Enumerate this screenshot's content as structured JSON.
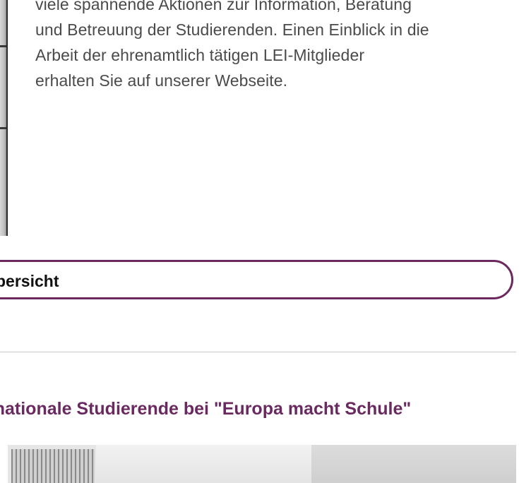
{
  "intro": {
    "lines": [
      "viele spannende Aktionen zur Information, Beratung",
      "und Betreuung der Studierenden. Einen Einblick in die",
      "Arbeit der ehrenamtlich tätigen LEI-Mitglieder",
      "erhalten Sie auf unserer Webseite."
    ]
  },
  "overview_link": {
    "label": "bersicht"
  },
  "news": {
    "title": "rnationale Studierende bei \"Europa macht Schule\""
  },
  "colors": {
    "accent": "#6a2a60",
    "text": "#4a4a4a",
    "divider": "#c9c9c9"
  }
}
